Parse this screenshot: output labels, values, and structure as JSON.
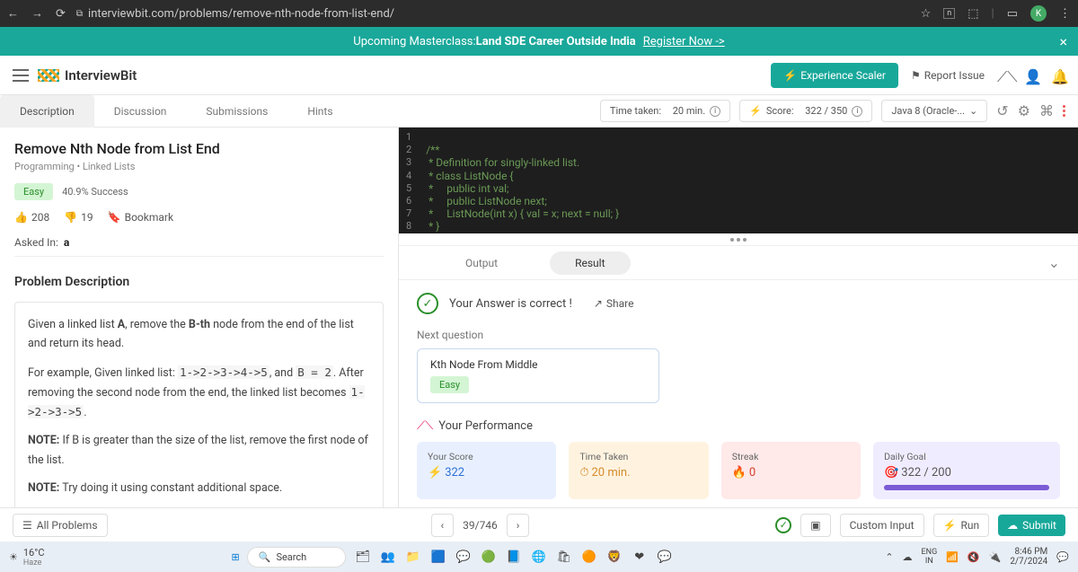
{
  "browser": {
    "url": "interviewbit.com/problems/remove-nth-node-from-list-end/",
    "avatar": "K"
  },
  "banner": {
    "prefix": "Upcoming Masterclass: ",
    "bold": "Land SDE Career Outside India",
    "link": "Register Now ->"
  },
  "topnav": {
    "brand": "InterviewBit",
    "scaler": "Experience Scaler",
    "report": "Report Issue"
  },
  "tabs": {
    "t0": "Description",
    "t1": "Discussion",
    "t2": "Submissions",
    "t3": "Hints"
  },
  "toolbar": {
    "time_label": "Time taken:",
    "time_value": "20 min.",
    "score_label": "Score:",
    "score_value": "322 / 350",
    "lang": "Java 8 (Oracle-..."
  },
  "problem": {
    "title": "Remove Nth Node from List End",
    "crumb1": "Programming",
    "crumb2": "Linked Lists",
    "difficulty": "Easy",
    "success": "40.9% Success",
    "likes": "208",
    "dislikes": "19",
    "bookmark": "Bookmark",
    "asked_label": "Asked In:",
    "asked_company": "a",
    "section": "Problem Description",
    "p1a": "Given a linked list ",
    "p1b": ", remove the ",
    "p1c": " node from the end of the list and return its head.",
    "p2a": "For example, Given linked list: ",
    "p2code1": "1->2->3->4->5",
    "p2b": ", and ",
    "p2code2": "B = 2",
    "p2c": ". After removing the second node from the end, the linked list becomes ",
    "p2code3": "1->2->3->5",
    "p2d": ".",
    "note1": " If B is greater than the size of the list, remove the first node of the list.",
    "note2": " Try doing it using constant additional space."
  },
  "code": {
    "l1": "/**",
    "l2": " * Definition for singly-linked list.",
    "l3": " * class ListNode {",
    "l4": " *     public int val;",
    "l5": " *     public ListNode next;",
    "l6": " *     ListNode(int x) { val = x; next = null; }",
    "l7": " * }",
    "l8": " */"
  },
  "gutter": {
    "g1": "1",
    "g2": "2",
    "g3": "3",
    "g4": "4",
    "g5": "5",
    "g6": "6",
    "g7": "7",
    "g8": "8"
  },
  "output": {
    "tab_output": "Output",
    "tab_result": "Result",
    "correct": "Your Answer is correct !",
    "share": "Share",
    "next_label": "Next question",
    "next_title": "Kth Node From Middle",
    "next_diff": "Easy",
    "perf_title": "Your Performance",
    "score_lbl": "Your Score",
    "score_val": "322",
    "time_lbl": "Time Taken",
    "time_val": "20 min.",
    "streak_lbl": "Streak",
    "streak_val": "0",
    "goal_lbl": "Daily Goal",
    "goal_val": "322 / 200"
  },
  "footer": {
    "all": "All Problems",
    "counter": "39/746",
    "custom": "Custom Input",
    "run": "Run",
    "submit": "Submit"
  },
  "taskbar": {
    "temp": "16°C",
    "cond": "Haze",
    "search": "Search",
    "lang1": "ENG",
    "lang2": "IN",
    "time": "8:46 PM",
    "date": "2/7/2024"
  }
}
